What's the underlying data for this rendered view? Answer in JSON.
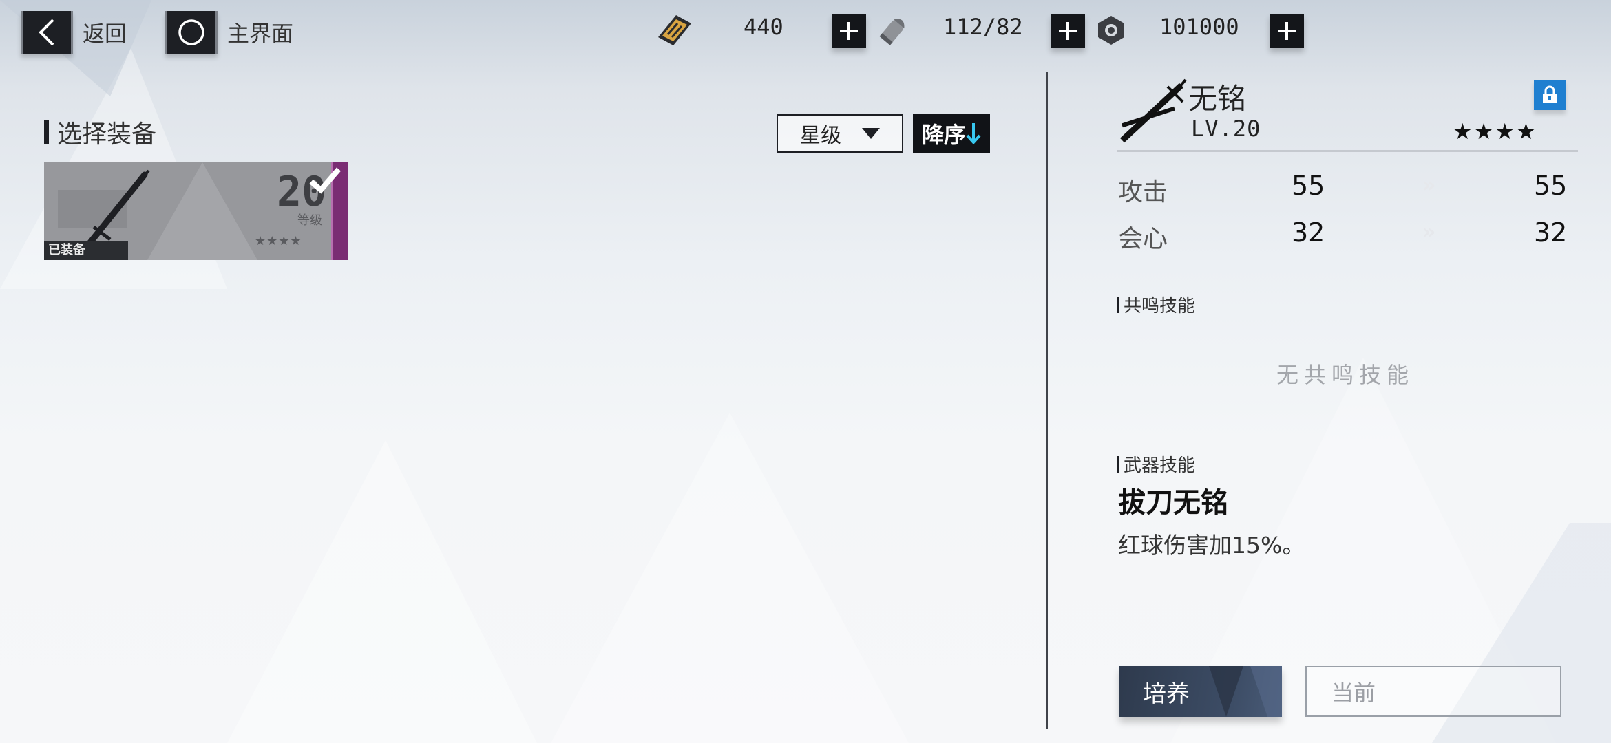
{
  "topbar": {
    "back_label": "返回",
    "home_label": "主界面",
    "resources": [
      {
        "name": "stamina",
        "icon": "ticket-icon",
        "value": "440"
      },
      {
        "name": "ammo",
        "icon": "bullet-icon",
        "value": "112/82"
      },
      {
        "name": "nuts",
        "icon": "nut-icon",
        "value": "101000"
      }
    ]
  },
  "left": {
    "title": "选择装备",
    "sort_field": "星级",
    "sort_order": "降序",
    "cards": [
      {
        "level": "20",
        "level_label": "等级",
        "stars": "★★★★",
        "equipped_label": "已装备",
        "selected": true
      }
    ]
  },
  "weapon": {
    "name": "无铭",
    "level": "LV.20",
    "stars": "★★★★",
    "stats": [
      {
        "label": "攻击",
        "current": "55",
        "next": "55"
      },
      {
        "label": "会心",
        "current": "32",
        "next": "32"
      }
    ],
    "resonance_title": "共鸣技能",
    "resonance_empty": "无共鸣技能",
    "weapon_skill_title": "武器技能",
    "skill_name": "拔刀无铭",
    "skill_desc": "红球伤害加15%。",
    "train_label": "培养",
    "current_label": "当前"
  },
  "colors": {
    "accent_blue": "#1f7fd0",
    "card_rarity": "#7a2c73",
    "sort_arrow": "#38c8f0"
  }
}
